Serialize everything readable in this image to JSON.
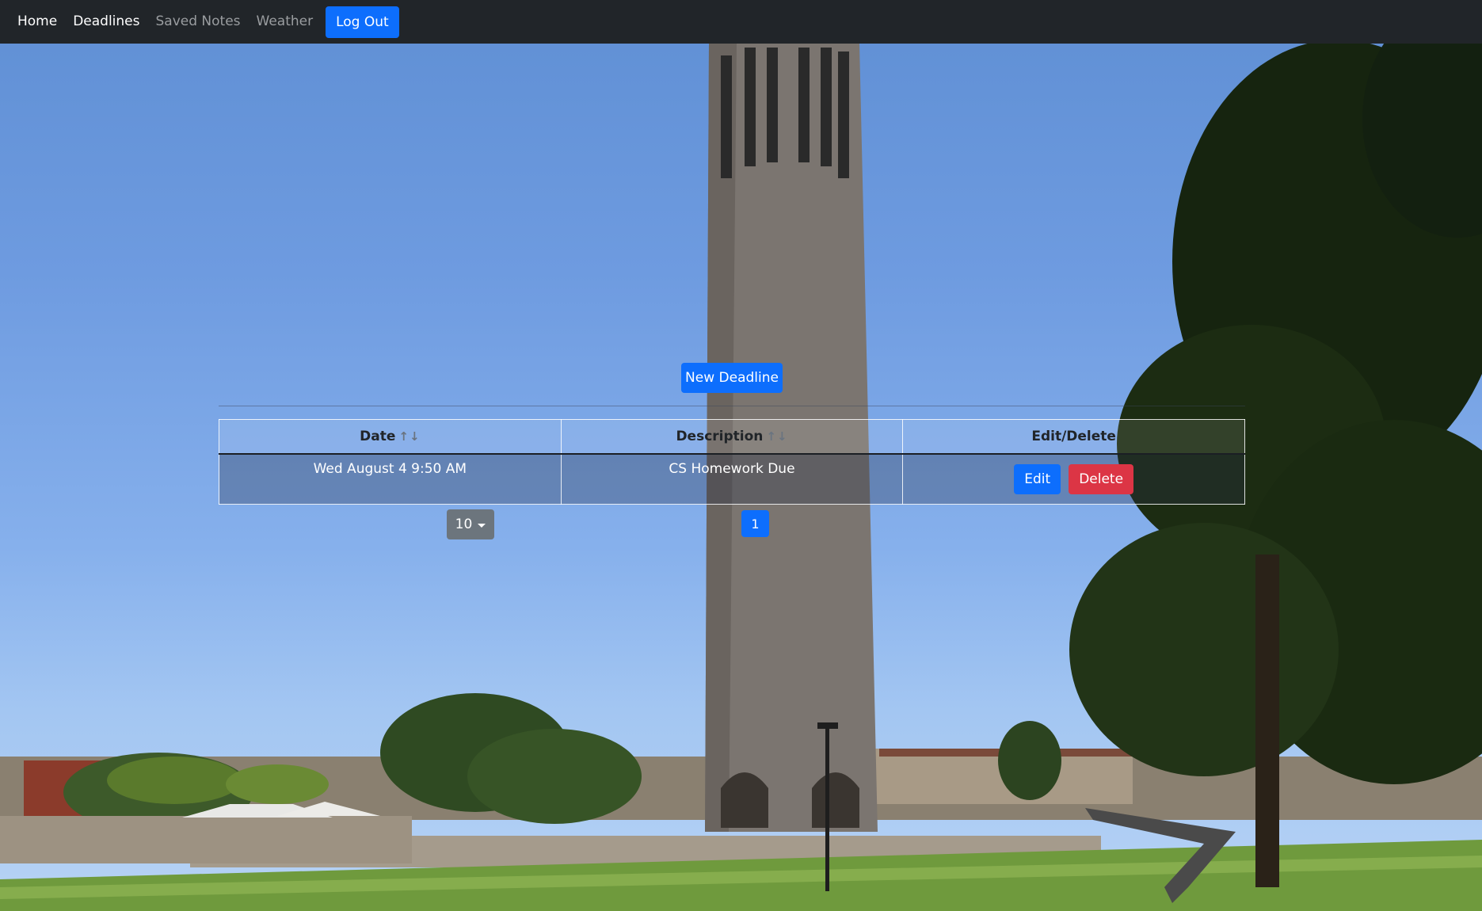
{
  "navbar": {
    "links": [
      {
        "label": "Home"
      },
      {
        "label": "Deadlines"
      },
      {
        "label": "Saved Notes"
      },
      {
        "label": "Weather"
      }
    ],
    "logout_label": "Log Out"
  },
  "actions": {
    "new_deadline_label": "New Deadline"
  },
  "table": {
    "headers": [
      {
        "label": "Date",
        "sort_icons": "↑↓"
      },
      {
        "label": "Description",
        "sort_icons": "↑↓"
      },
      {
        "label": "Edit/Delete"
      }
    ],
    "rows": [
      {
        "date": "Wed August 4 9:50 AM",
        "description": "CS Homework Due",
        "edit_label": "Edit",
        "delete_label": "Delete"
      }
    ]
  },
  "pagination": {
    "page_size": "10",
    "current_page": "1"
  },
  "colors": {
    "navbar": "#212529",
    "primary": "#0d6efd",
    "danger": "#dc3545",
    "secondary": "#6c757d"
  },
  "background": {
    "icon": "clock-tower-photo"
  }
}
